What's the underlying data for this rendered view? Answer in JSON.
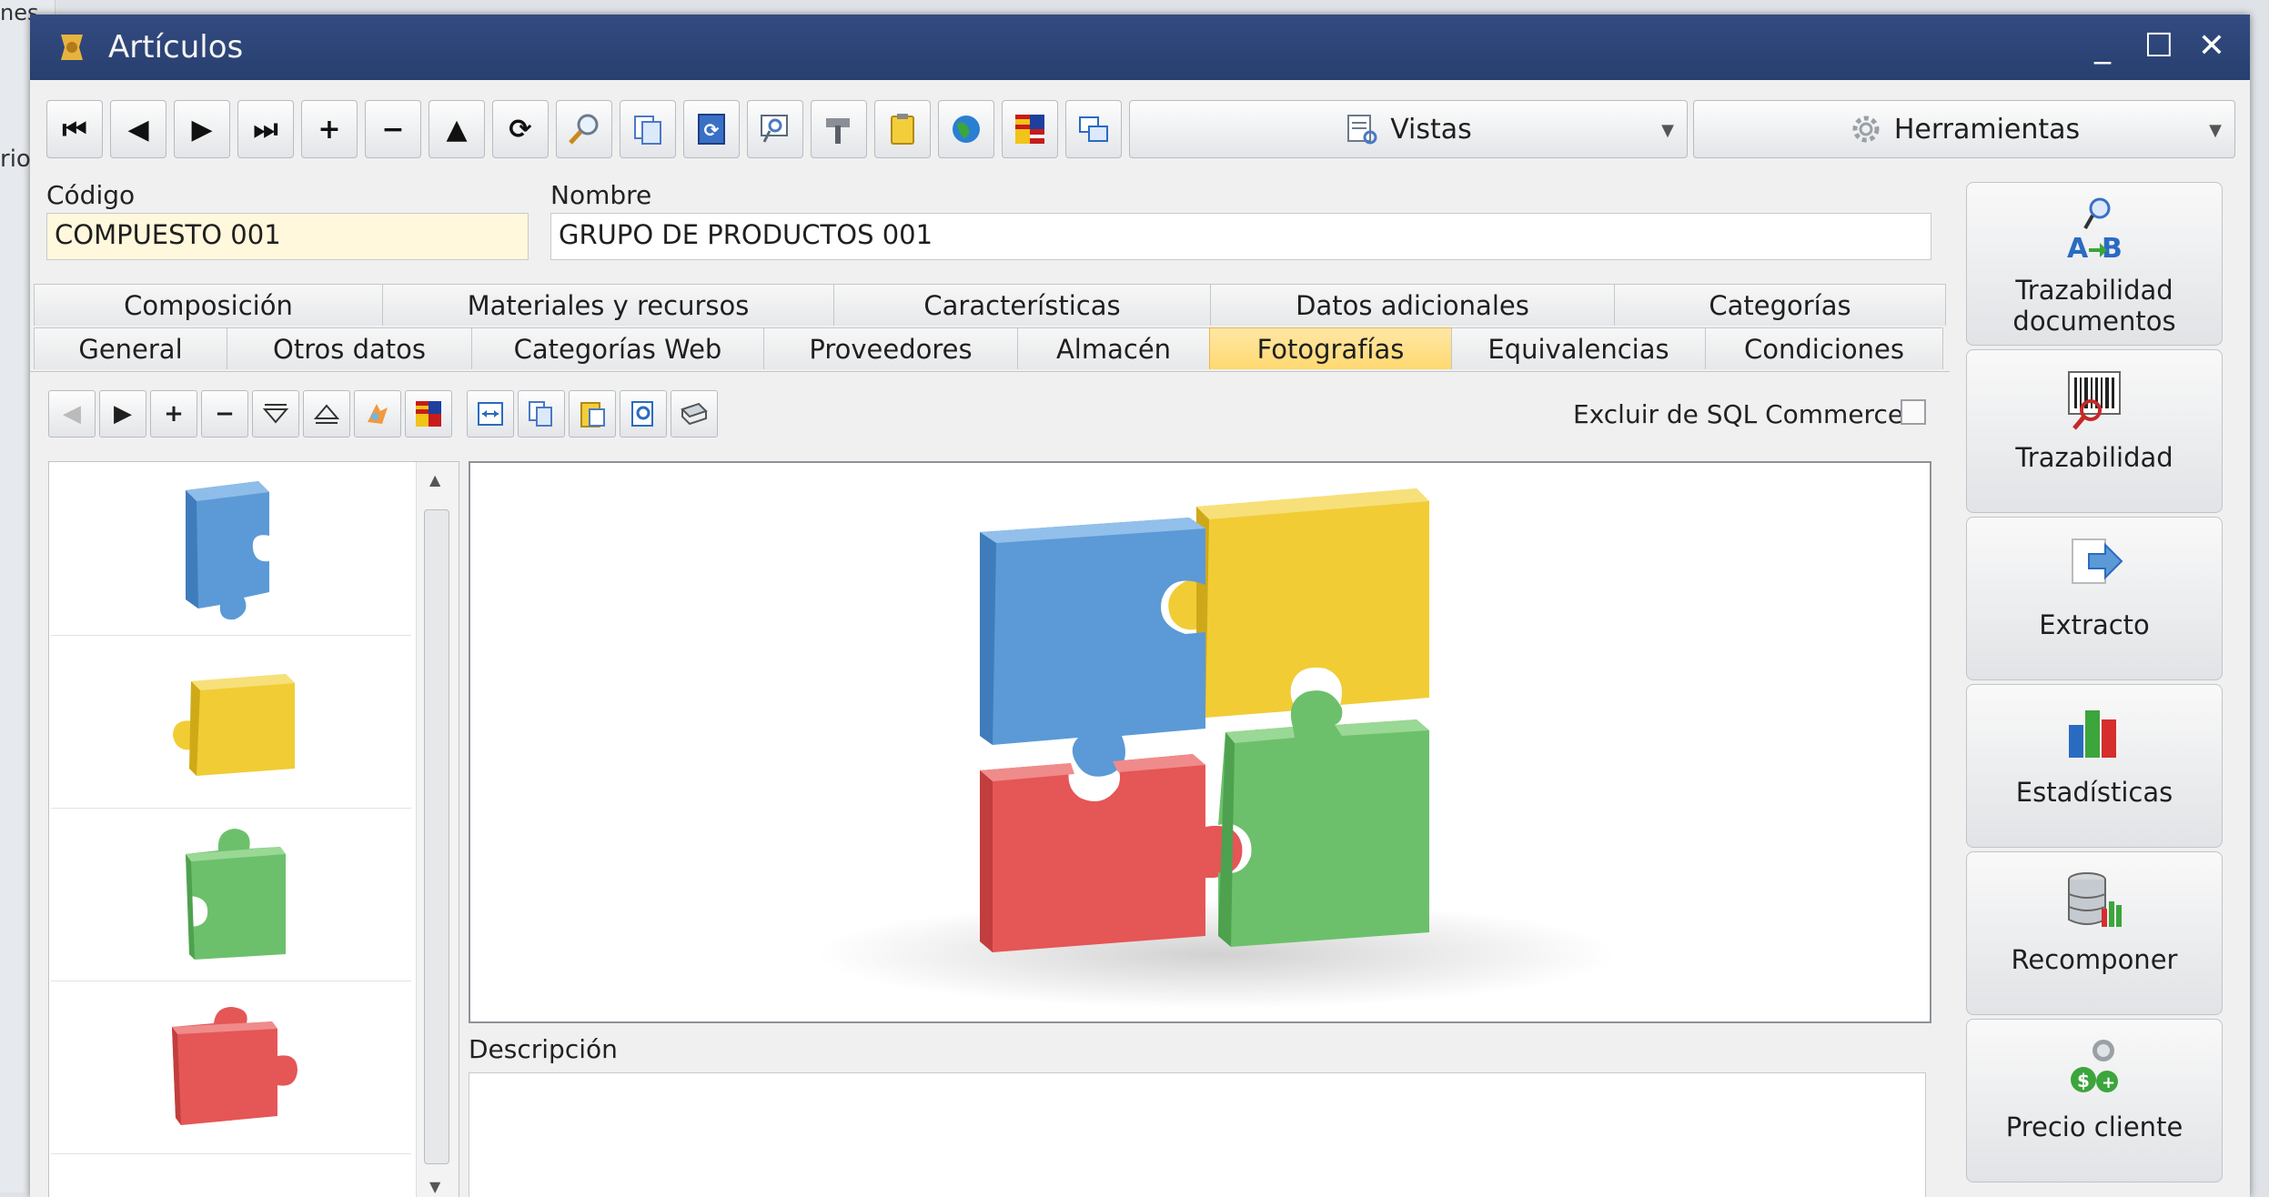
{
  "background_window": {
    "partial_top": "nes",
    "partial_label": "rio"
  },
  "window": {
    "title": "Artículos",
    "minimize": "_",
    "maximize": "☐",
    "close": "✕"
  },
  "toolbar": {
    "first": "⏮",
    "prev": "◀",
    "next": "▶",
    "last": "⏭",
    "add": "+",
    "remove": "−",
    "up": "▲",
    "refresh": "⟳",
    "vistas_label": "Vistas",
    "herramientas_label": "Herramientas"
  },
  "fields": {
    "codigo_label": "Código",
    "codigo_value": "COMPUESTO 001",
    "nombre_label": "Nombre",
    "nombre_value": "GRUPO DE PRODUCTOS 001"
  },
  "tabs_row1": [
    "Composición",
    "Materiales y recursos",
    "Características",
    "Datos adicionales",
    "Categorías"
  ],
  "tabs_row2": [
    "General",
    "Otros datos",
    "Categorías Web",
    "Proveedores",
    "Almacén",
    "Fotografías",
    "Equivalencias",
    "Condiciones"
  ],
  "active_tab": "Fotografías",
  "photos": {
    "excluir_label": "Excluir de SQL Commerce",
    "excluir_checked": false,
    "descripcion_label": "Descripción",
    "descripcion_value": "",
    "thumbnails": [
      "blue-puzzle-piece",
      "yellow-puzzle-piece",
      "green-puzzle-piece",
      "red-puzzle-piece"
    ]
  },
  "sidebar": {
    "trazabilidad_documentos": "Trazabilidad documentos",
    "trazabilidad": "Trazabilidad",
    "extracto": "Extracto",
    "estadisticas": "Estadísticas",
    "recomponer": "Recomponer",
    "precio_cliente": "Precio cliente"
  },
  "colors": {
    "titlebar": "#2d4577",
    "active_tab": "#ffd970",
    "codigo_bg": "#fff8dc",
    "puzzle_blue": "#5b9ad6",
    "puzzle_yellow": "#f1cc35",
    "puzzle_green": "#6cc06b",
    "puzzle_red": "#e55656"
  }
}
